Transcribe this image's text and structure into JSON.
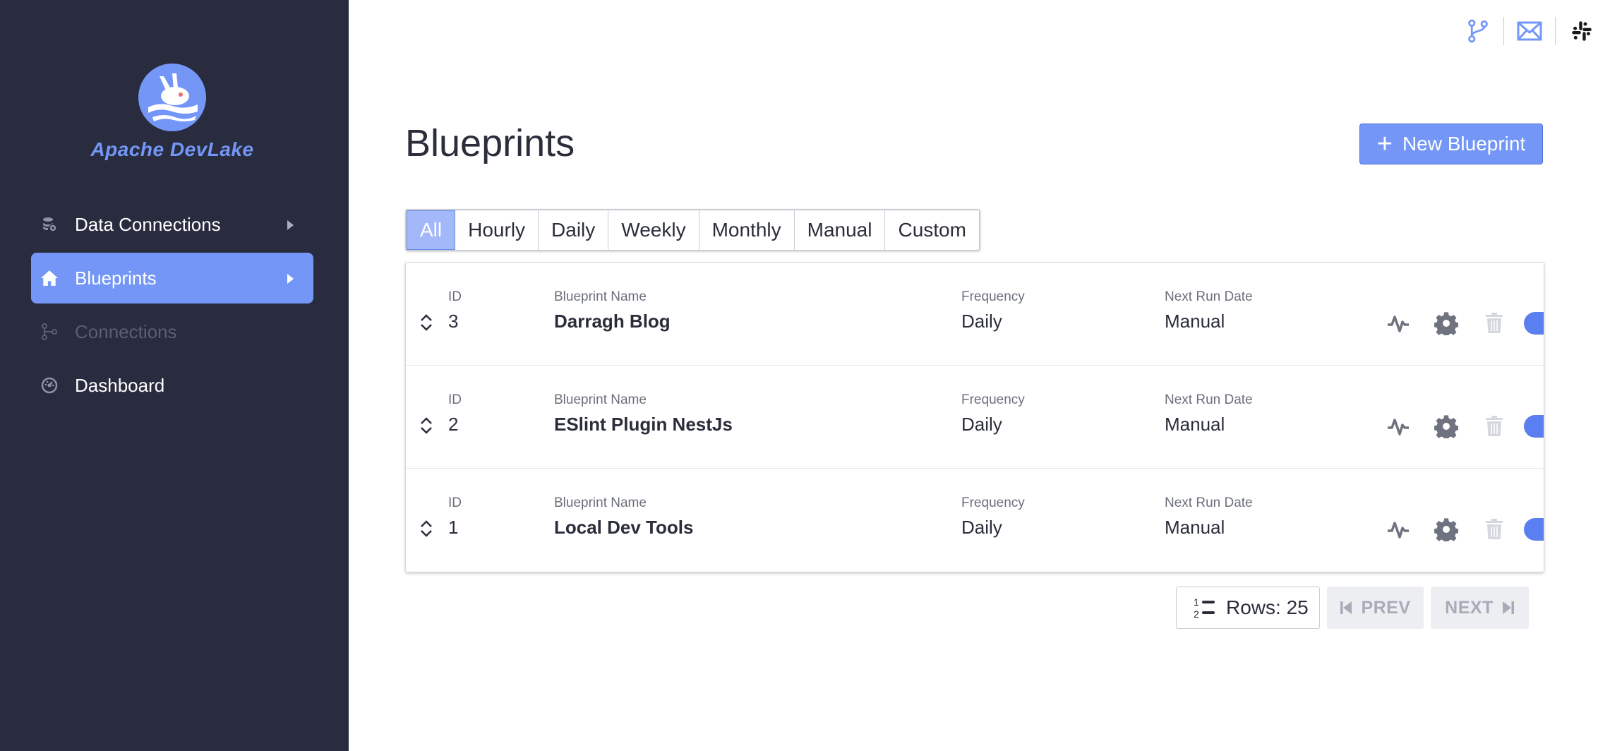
{
  "app": {
    "logo_text": "Apache DevLake"
  },
  "sidebar": {
    "items": [
      {
        "label": "Data Connections",
        "icon": "database-icon",
        "active": false,
        "disabled": false,
        "has_caret": true
      },
      {
        "label": "Blueprints",
        "icon": "home-icon",
        "active": true,
        "disabled": false,
        "has_caret": true
      },
      {
        "label": "Connections",
        "icon": "git-branch-icon",
        "active": false,
        "disabled": true,
        "has_caret": false
      },
      {
        "label": "Dashboard",
        "icon": "dashboard-icon",
        "active": false,
        "disabled": false,
        "has_caret": false
      }
    ]
  },
  "topbar": {
    "icons": [
      "git-branch-icon",
      "mail-icon",
      "slack-icon"
    ]
  },
  "main": {
    "title": "Blueprints",
    "new_button_label": "New Blueprint",
    "filters": [
      "All",
      "Hourly",
      "Daily",
      "Weekly",
      "Monthly",
      "Manual",
      "Custom"
    ],
    "active_filter": "All",
    "columns": {
      "id": "ID",
      "name": "Blueprint Name",
      "frequency": "Frequency",
      "next_run": "Next Run Date"
    },
    "rows": [
      {
        "id": "3",
        "name": "Darragh Blog",
        "frequency": "Daily",
        "next_run": "Manual",
        "enabled": true
      },
      {
        "id": "2",
        "name": "ESlint Plugin NestJs",
        "frequency": "Daily",
        "next_run": "Manual",
        "enabled": true
      },
      {
        "id": "1",
        "name": "Local Dev Tools",
        "frequency": "Daily",
        "next_run": "Manual",
        "enabled": true
      }
    ]
  },
  "pagination": {
    "rows_label": "Rows: 25",
    "prev_label": "PREV",
    "next_label": "NEXT"
  },
  "colors": {
    "sidebar_bg": "#292b3f",
    "accent": "#7497f7",
    "toggle_on": "#5b7ff0"
  }
}
